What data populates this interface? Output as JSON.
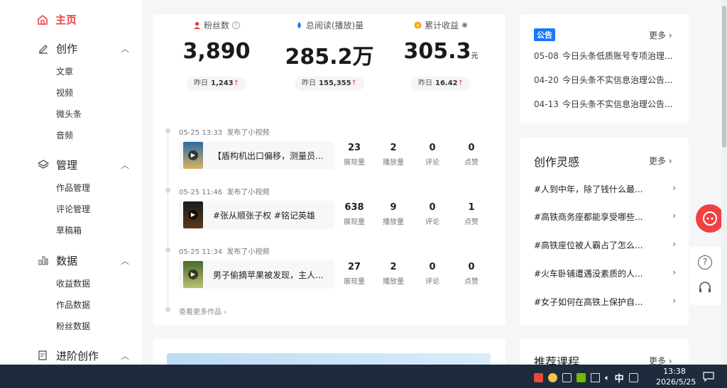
{
  "sidebar": {
    "home": "主页",
    "groups": [
      {
        "label": "创作",
        "items": [
          "文章",
          "视频",
          "微头条",
          "音频"
        ]
      },
      {
        "label": "管理",
        "items": [
          "作品管理",
          "评论管理",
          "草稿箱"
        ]
      },
      {
        "label": "数据",
        "items": [
          "收益数据",
          "作品数据",
          "粉丝数据"
        ]
      },
      {
        "label": "进阶创作",
        "items": []
      }
    ]
  },
  "stats": [
    {
      "label": "粉丝数",
      "value": "3,890",
      "unit": "",
      "yesterday_label": "昨日",
      "yesterday_value": "1,243",
      "icon": "user-icon",
      "color": "#f04142"
    },
    {
      "label": "总阅读(播放)量",
      "value": "285.2万",
      "unit": "",
      "yesterday_label": "昨日",
      "yesterday_value": "155,355",
      "icon": "drop-icon",
      "color": "#1677ff"
    },
    {
      "label": "累计收益",
      "value": "305.3",
      "unit": "元",
      "yesterday_label": "昨日",
      "yesterday_value": "16.42",
      "icon": "coin-icon",
      "color": "#f5a623"
    }
  ],
  "posts": [
    {
      "time": "05-25 13:33",
      "action": "发布了小视频",
      "title": "【盾构机出口偏移，测量员...",
      "metrics": [
        "23",
        "2",
        "0",
        "0"
      ]
    },
    {
      "time": "05-25 11:46",
      "action": "发布了小视频",
      "title": "#张从顺张子权 #铭记英雄",
      "metrics": [
        "638",
        "9",
        "0",
        "1"
      ]
    },
    {
      "time": "05-25 11:34",
      "action": "发布了小视频",
      "title": "男子偷摘苹果被发现，主人...",
      "metrics": [
        "27",
        "2",
        "0",
        "0"
      ]
    }
  ],
  "metric_labels": [
    "展现量",
    "播放量",
    "评论",
    "点赞"
  ],
  "more_works": "查看更多作品",
  "announcement": {
    "tag": "公告",
    "more": "更多",
    "items": [
      {
        "date": "05-08",
        "text": "今日头条低质账号专项治理..."
      },
      {
        "date": "04-20",
        "text": "今日头条不实信息治理公告..."
      },
      {
        "date": "04-13",
        "text": "今日头条不实信息治理公告..."
      }
    ]
  },
  "inspiration": {
    "title": "创作灵感",
    "more": "更多",
    "items": [
      "#人到中年，除了钱什么最...",
      "#高铁商务座都能享受哪些...",
      "#高铁座位被人霸占了怎么...",
      "#火车卧铺遭遇没素质的人...",
      "#女子如何在高铁上保护自..."
    ]
  },
  "courses": {
    "title": "推荐课程",
    "more": "更多"
  },
  "taskbar": {
    "ime": "中",
    "time": "13:38",
    "date": "2026/5/25"
  }
}
